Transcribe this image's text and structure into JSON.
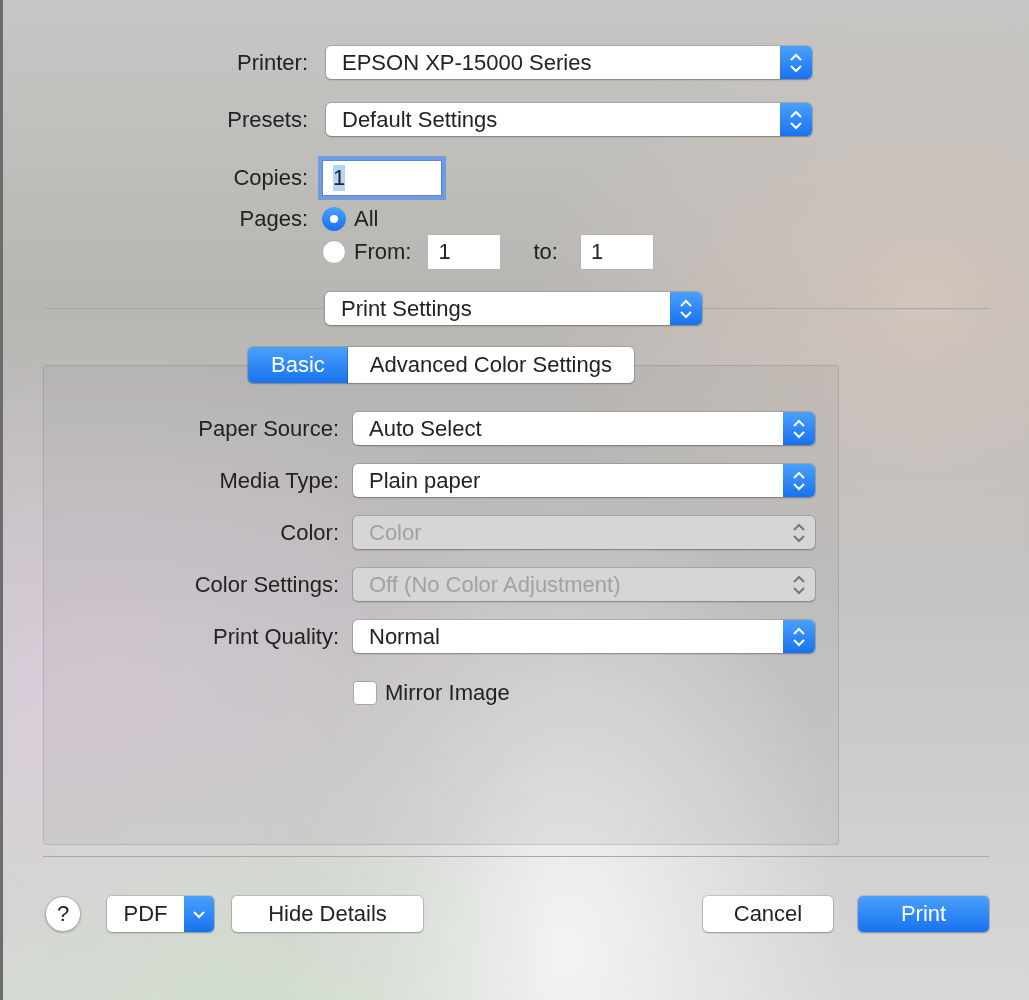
{
  "printer": {
    "label": "Printer:",
    "value": "EPSON XP-15000 Series"
  },
  "presets": {
    "label": "Presets:",
    "value": "Default Settings"
  },
  "copies": {
    "label": "Copies:",
    "value": "1"
  },
  "pages": {
    "label": "Pages:",
    "options": [
      {
        "label": "All",
        "selected": true
      },
      {
        "label": "From:",
        "selected": false,
        "from": "1",
        "to_label": "to:",
        "to": "1"
      }
    ]
  },
  "section": {
    "value": "Print Settings"
  },
  "tabs": [
    {
      "label": "Basic",
      "selected": true
    },
    {
      "label": "Advanced Color Settings",
      "selected": false
    }
  ],
  "settings": [
    {
      "label": "Paper Source:",
      "value": "Auto Select",
      "disabled": false
    },
    {
      "label": "Media Type:",
      "value": "Plain paper",
      "disabled": false
    },
    {
      "label": "Color:",
      "value": "Color",
      "disabled": true
    },
    {
      "label": "Color Settings:",
      "value": "Off (No Color Adjustment)",
      "disabled": true
    },
    {
      "label": "Print Quality:",
      "value": "Normal",
      "disabled": false
    }
  ],
  "mirror": {
    "label": "Mirror Image",
    "checked": false
  },
  "footer": {
    "help": "?",
    "pdf": "PDF",
    "hide_details": "Hide Details",
    "cancel": "Cancel",
    "print": "Print"
  }
}
